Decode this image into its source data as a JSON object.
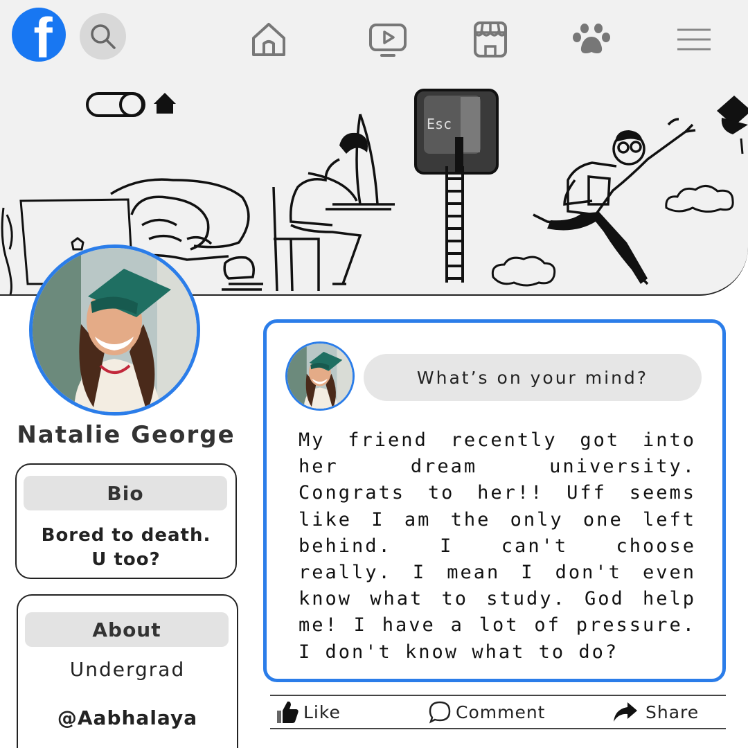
{
  "nav": {
    "logo_letter": "f",
    "icons": [
      "search-icon",
      "home-icon",
      "video-icon",
      "marketplace-icon",
      "groups-icon",
      "menu-icon"
    ]
  },
  "profile": {
    "name": "Natalie George"
  },
  "bio": {
    "heading": "Bio",
    "line1": "Bored to death.",
    "line2": "U too?"
  },
  "about": {
    "heading": "About",
    "status": "Undergrad",
    "handle": "@Aabhalaya"
  },
  "post": {
    "prompt": "What’s on your mind?",
    "text": "My friend recently got into her dream university. Congrats to her!! Uff seems like I am the only one left behind. I can't choose really. I mean I don't even know what to study. God help me! I have a lot of pressure. I don't know what to do?"
  },
  "actions": {
    "like": "Like",
    "comment": "Comment",
    "share": "Share"
  },
  "cover_art": {
    "key_label": "Esc"
  },
  "colors": {
    "brand_blue": "#1877f2",
    "accent_blue": "#2b7de9",
    "card_head": "#e3e3e3",
    "cover_bg": "#f1f1f1"
  }
}
